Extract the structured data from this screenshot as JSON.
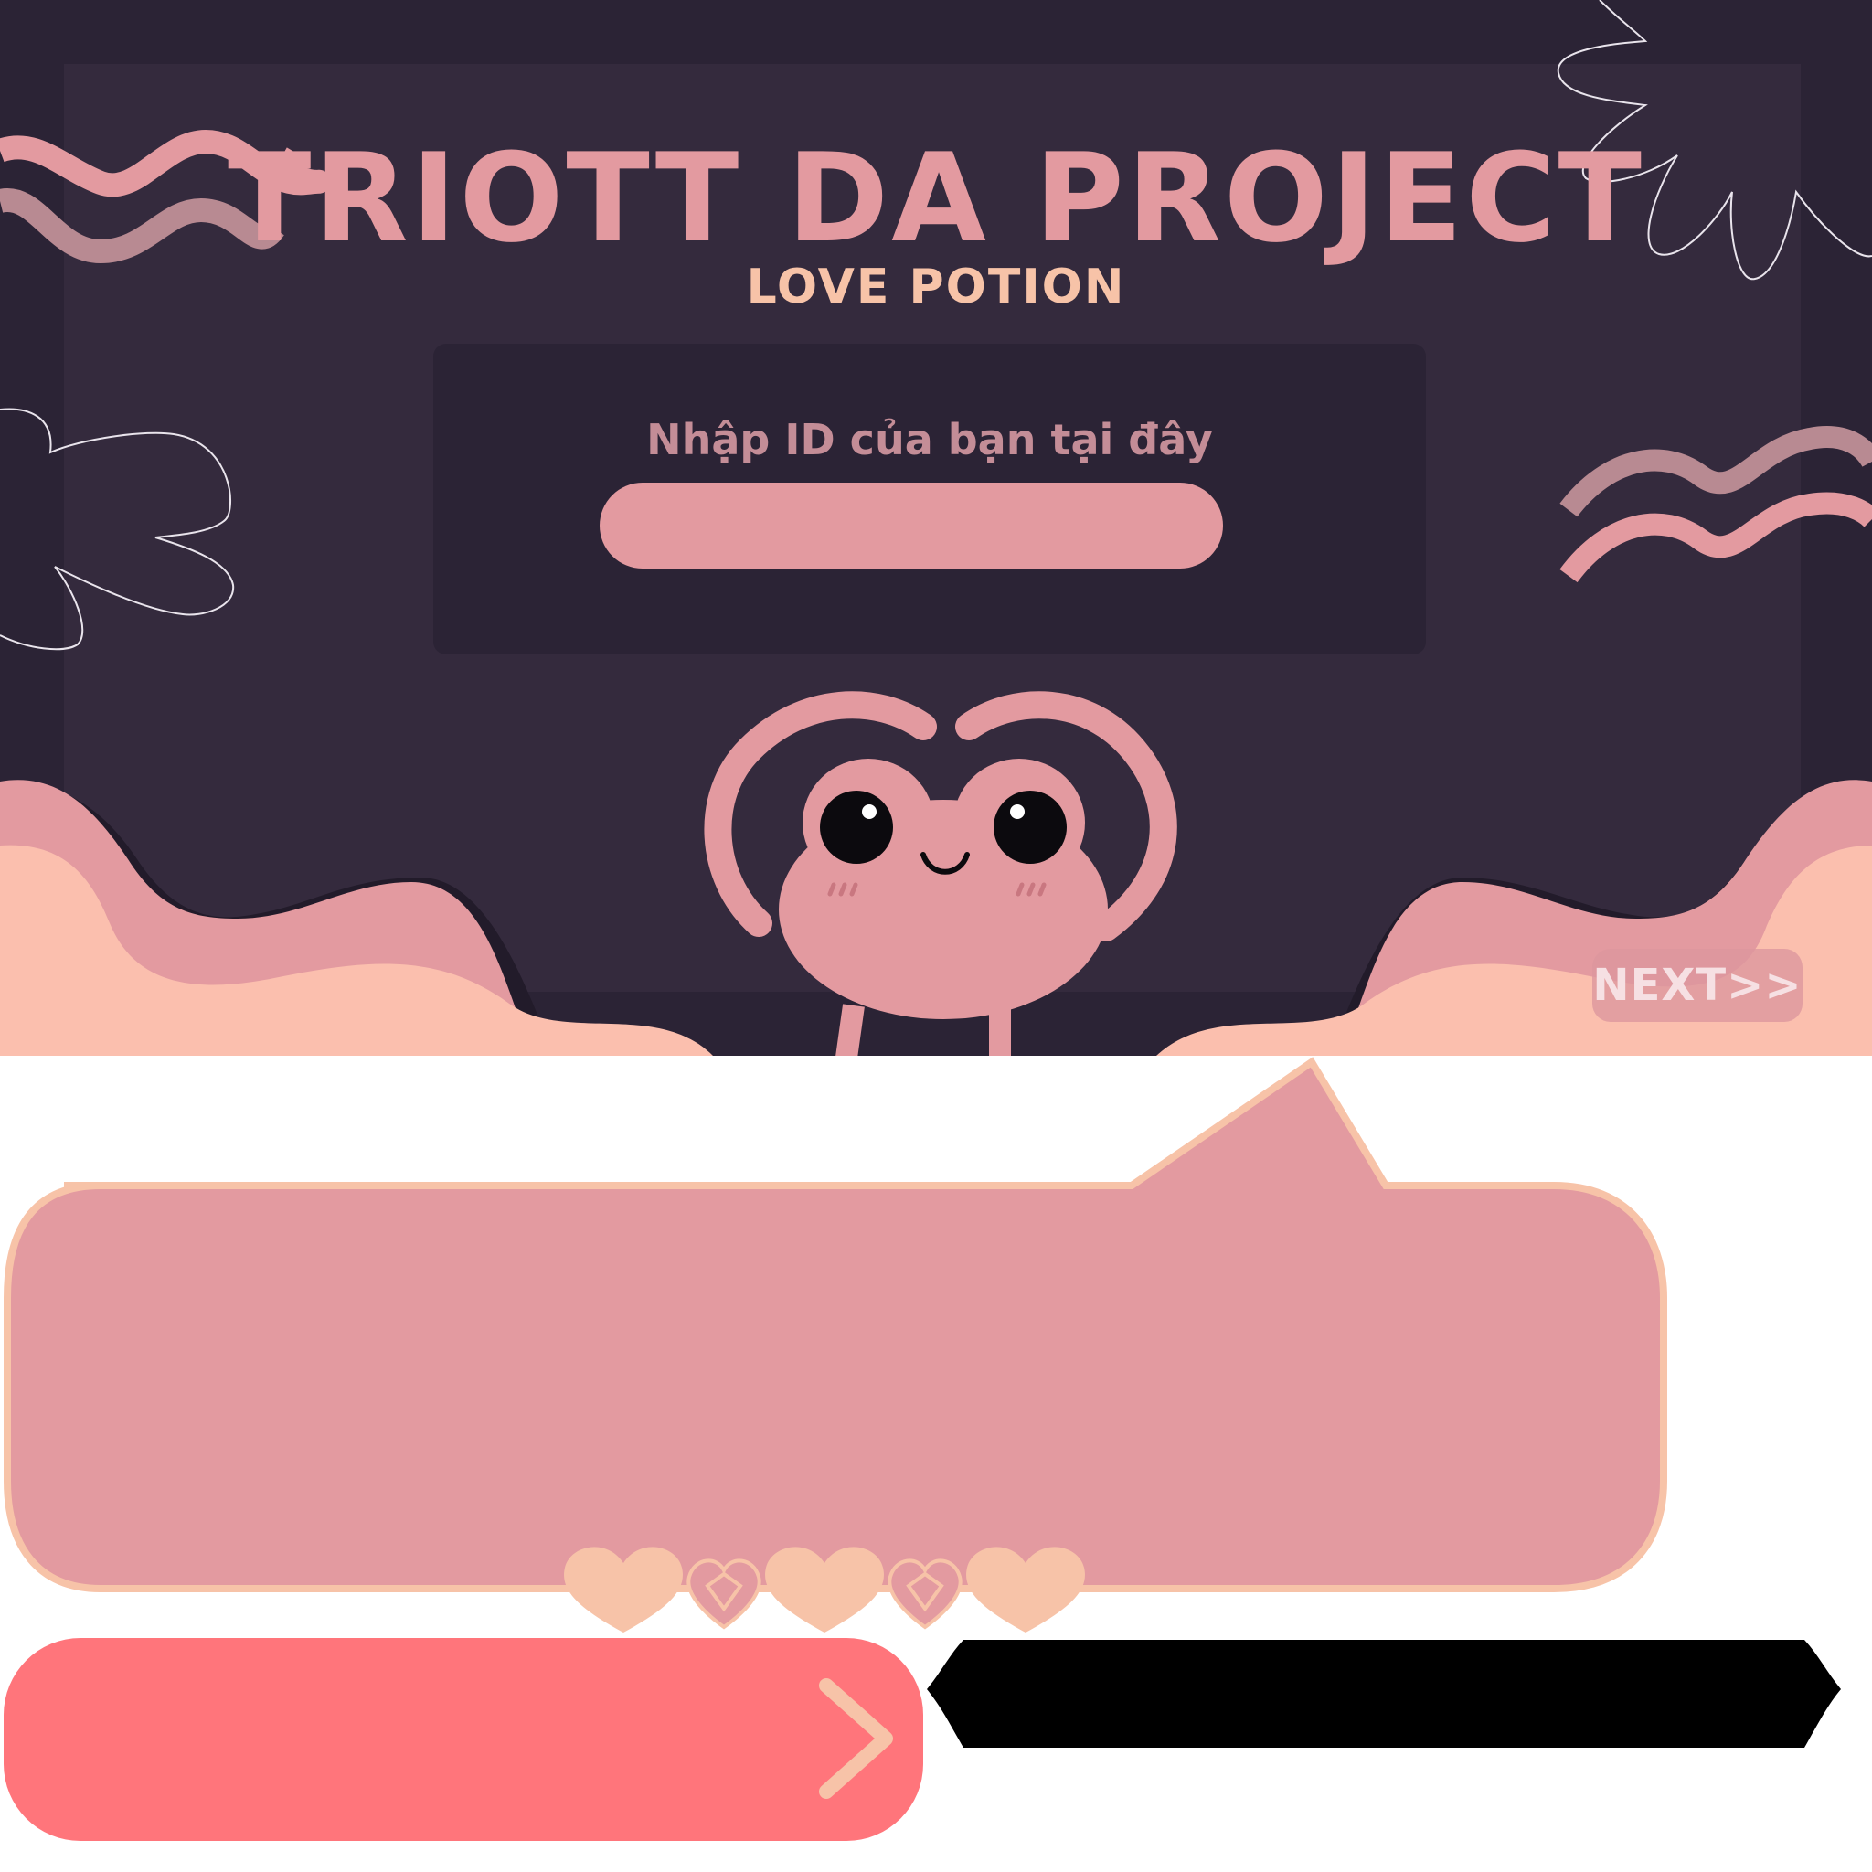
{
  "header": {
    "title": "TRIOTT DA PROJECT",
    "subtitle": "LOVE POTION"
  },
  "id_form": {
    "label": "Nhập ID của bạn tại đây",
    "input_value": "",
    "placeholder": ""
  },
  "next_button": {
    "label": "NEXT>>"
  },
  "colors": {
    "background": "#2b2335",
    "panel": "#342a3d",
    "pink": "#e39aa0",
    "peach": "#f7c3a8",
    "coral": "#ff757b",
    "mauve": "#b88a92"
  },
  "icons": [
    "heart-icon",
    "diamond-icon",
    "chevron-right-icon",
    "mascot"
  ]
}
